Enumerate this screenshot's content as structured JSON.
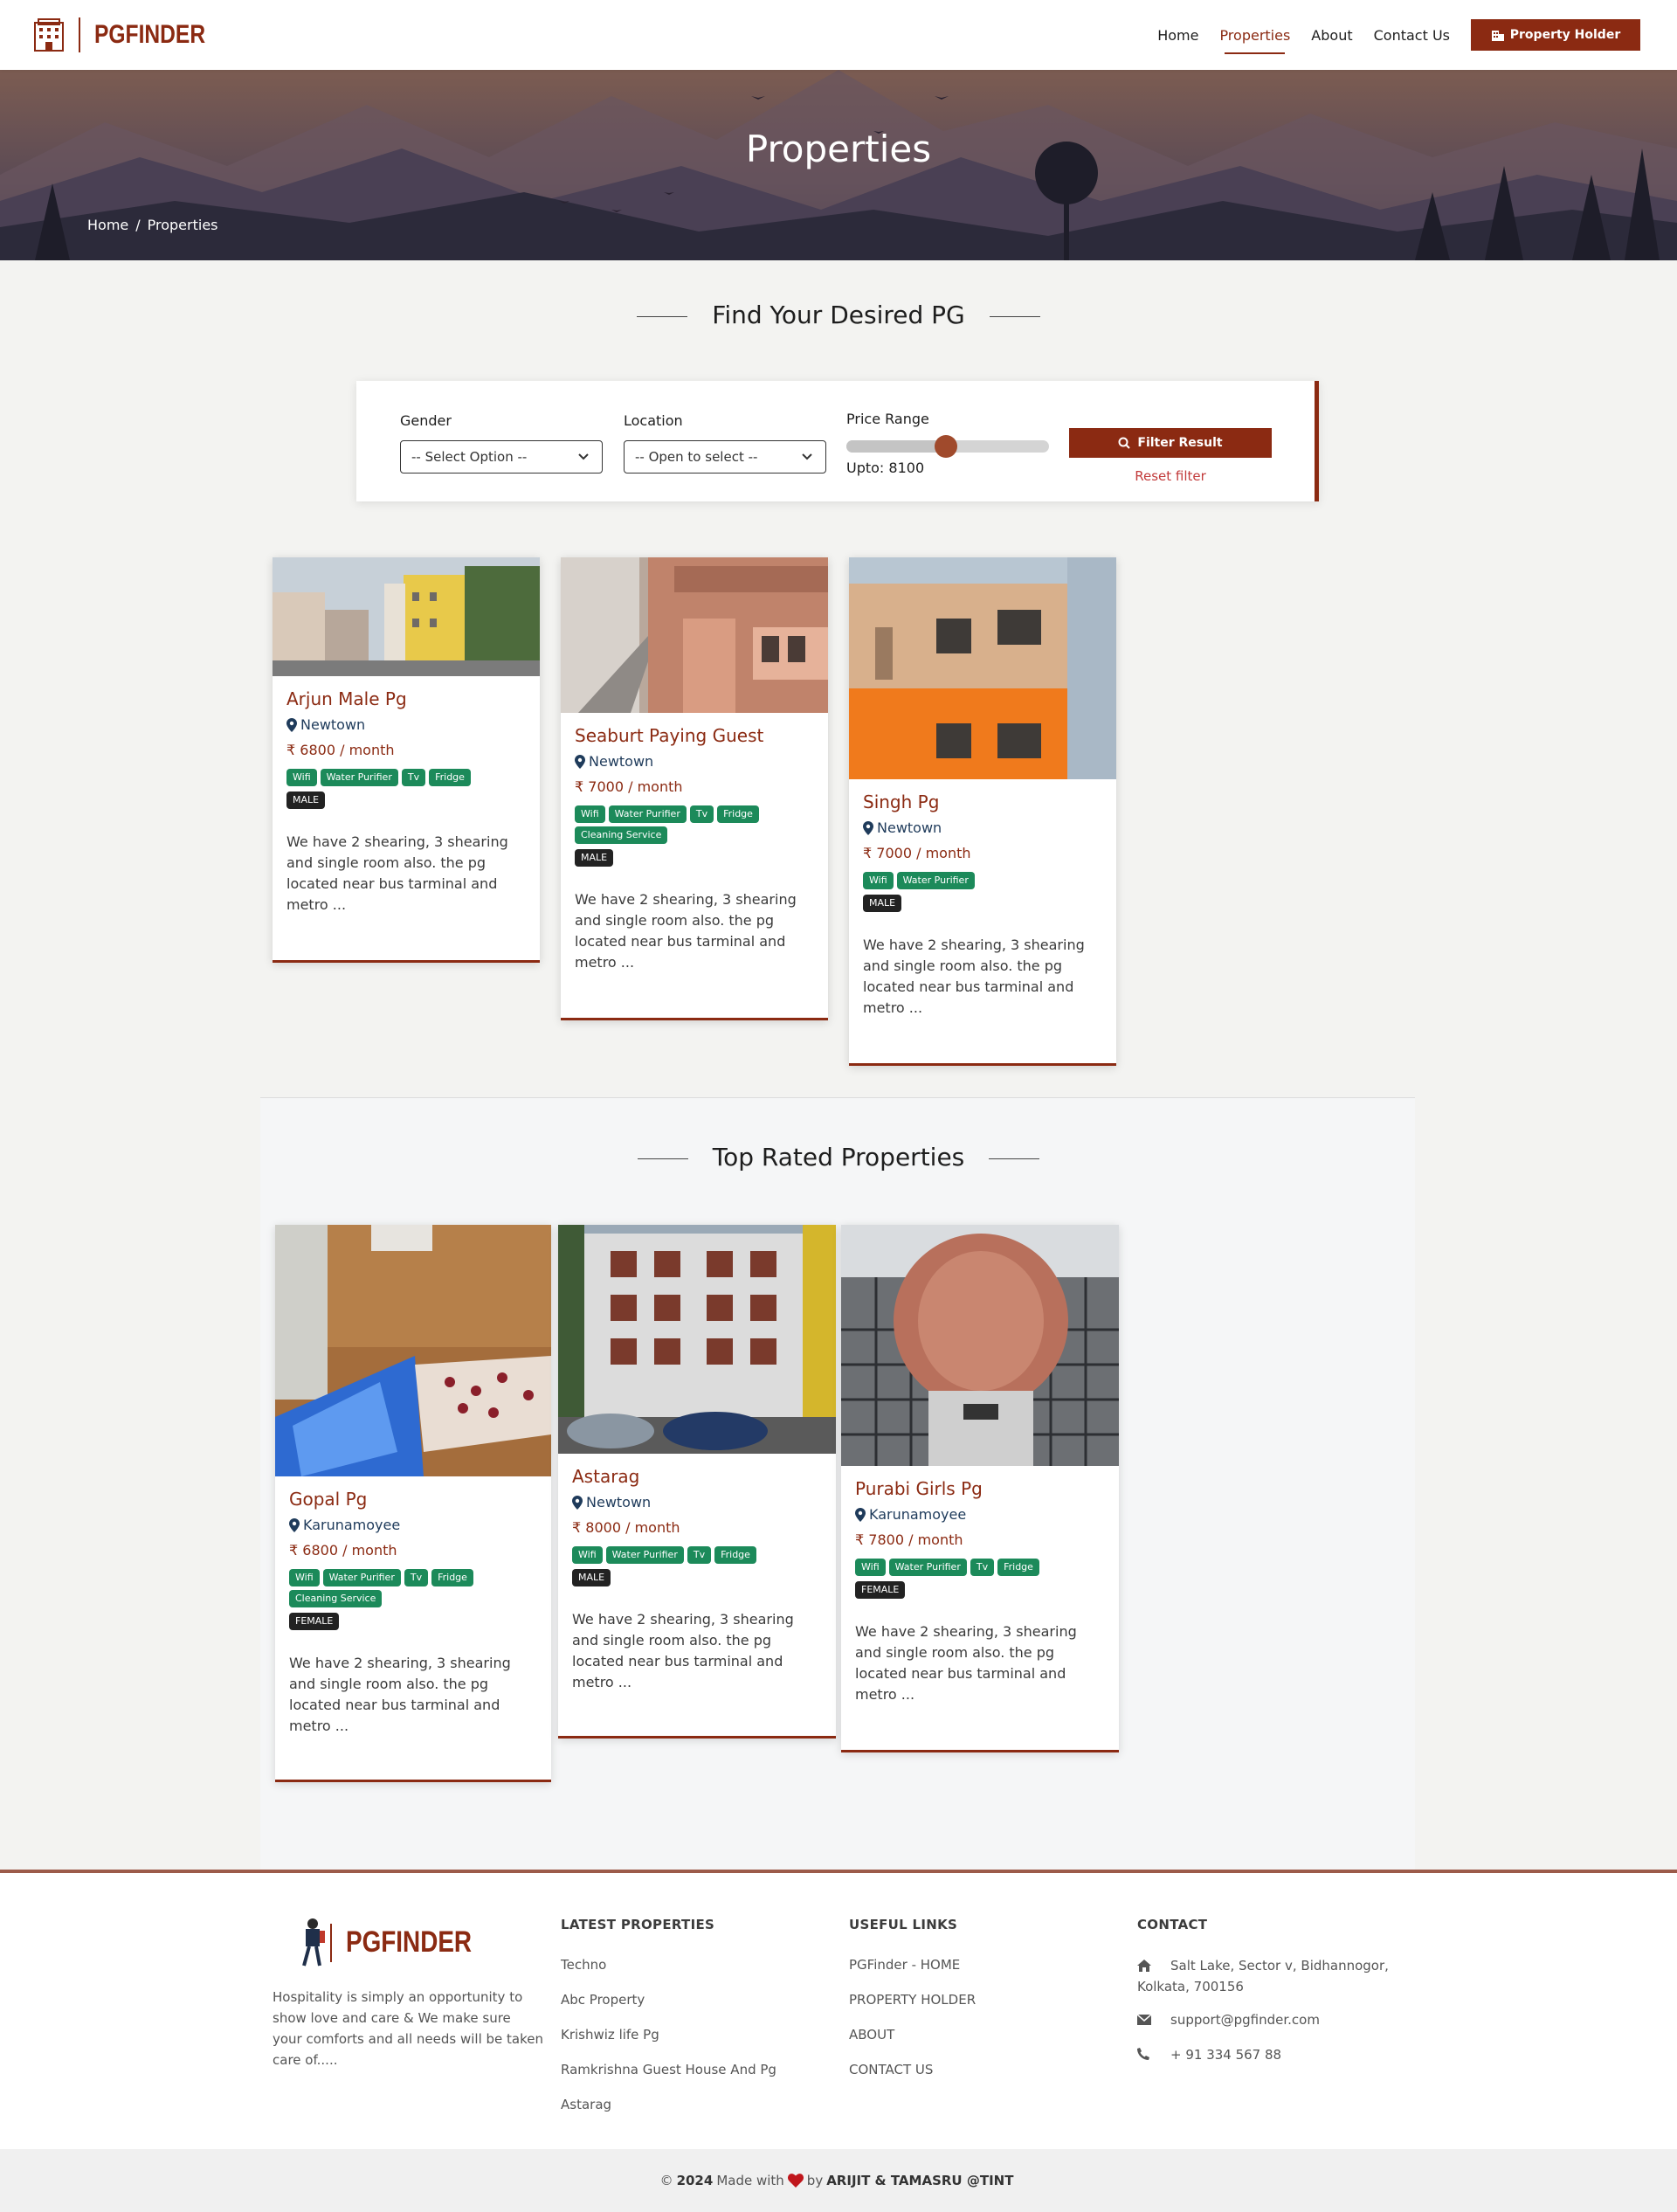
{
  "brand": {
    "name": "PGFINDER",
    "accent": "#8b2a12"
  },
  "nav": {
    "items": [
      {
        "label": "Home"
      },
      {
        "label": "Properties"
      },
      {
        "label": "About"
      },
      {
        "label": "Contact Us"
      }
    ],
    "active": "Properties",
    "holder_label": "Property Holder"
  },
  "hero": {
    "title": "Properties",
    "breadcrumb": {
      "home": "Home",
      "sep": "/",
      "current": "Properties"
    }
  },
  "search": {
    "heading": "Find Your Desired PG",
    "gender_label": "Gender",
    "gender_value": "-- Select Option --",
    "location_label": "Location",
    "location_value": "-- Open to select --",
    "price_label": "Price Range",
    "price_upto": "Upto: 8100",
    "price_level_fraction": 0.5,
    "filter_label": "Filter Result",
    "reset_label": "Reset filter"
  },
  "properties": [
    {
      "title": "Arjun Male Pg",
      "location": "Newtown",
      "price": "6800 / month",
      "amenities": [
        "Wifi",
        "Water Purifier",
        "Tv",
        "Fridge"
      ],
      "gender": "MALE",
      "desc": "We have 2 shearing, 3 shearing and single room also. the pg located near bus tarminal and metro ..."
    },
    {
      "title": "Seaburt Paying Guest",
      "location": "Newtown",
      "price": "7000 / month",
      "amenities": [
        "Wifi",
        "Water Purifier",
        "Tv",
        "Fridge",
        "Cleaning Service"
      ],
      "gender": "MALE",
      "desc": "We have 2 shearing, 3 shearing and single room also. the pg located near bus tarminal and metro ..."
    },
    {
      "title": "Singh Pg",
      "location": "Newtown",
      "price": "7000 / month",
      "amenities": [
        "Wifi",
        "Water Purifier"
      ],
      "gender": "MALE",
      "desc": "We have 2 shearing, 3 shearing and single room also. the pg located near bus tarminal and metro ..."
    }
  ],
  "top_rated": {
    "heading": "Top Rated Properties",
    "items": [
      {
        "title": "Gopal Pg",
        "location": "Karunamoyee",
        "price": "6800 / month",
        "amenities": [
          "Wifi",
          "Water Purifier",
          "Tv",
          "Fridge",
          "Cleaning Service"
        ],
        "gender": "FEMALE",
        "desc": "We have 2 shearing, 3 shearing and single room also. the pg located near bus tarminal and metro ..."
      },
      {
        "title": "Astarag",
        "location": "Newtown",
        "price": "8000 / month",
        "amenities": [
          "Wifi",
          "Water Purifier",
          "Tv",
          "Fridge"
        ],
        "gender": "MALE",
        "desc": "We have 2 shearing, 3 shearing and single room also. the pg located near bus tarminal and metro ..."
      },
      {
        "title": "Purabi Girls Pg",
        "location": "Karunamoyee",
        "price": "7800 / month",
        "amenities": [
          "Wifi",
          "Water Purifier",
          "Tv",
          "Fridge"
        ],
        "gender": "FEMALE",
        "desc": "We have 2 shearing, 3 shearing and single room also. the pg located near bus tarminal and metro ..."
      }
    ]
  },
  "currency_symbol": "₹",
  "footer": {
    "logo_text": "PGFINDER",
    "about": "Hospitality is simply an opportunity to show love and care & We make sure your comforts and all needs will be taken care of.....",
    "latest_title": "LATEST PROPERTIES",
    "latest": [
      "Techno",
      "Abc Property",
      "Krishwiz life Pg",
      "Ramkrishna Guest House And Pg",
      "Astarag"
    ],
    "useful_title": "USEFUL LINKS",
    "useful": [
      "PGFinder - HOME",
      "PROPERTY HOLDER",
      "ABOUT",
      "CONTACT US"
    ],
    "contact_title": "CONTACT",
    "address": "Salt Lake, Sector v, Bidhannogor, Kolkata, 700156",
    "email": "support@pgfinder.com",
    "phone": "+ 91 334 567 88"
  },
  "copyright": {
    "prefix": "©",
    "year": "2024",
    "made_with": "Made with",
    "by": "by",
    "authors": "ARIJIT & TAMASRU @TINT"
  }
}
